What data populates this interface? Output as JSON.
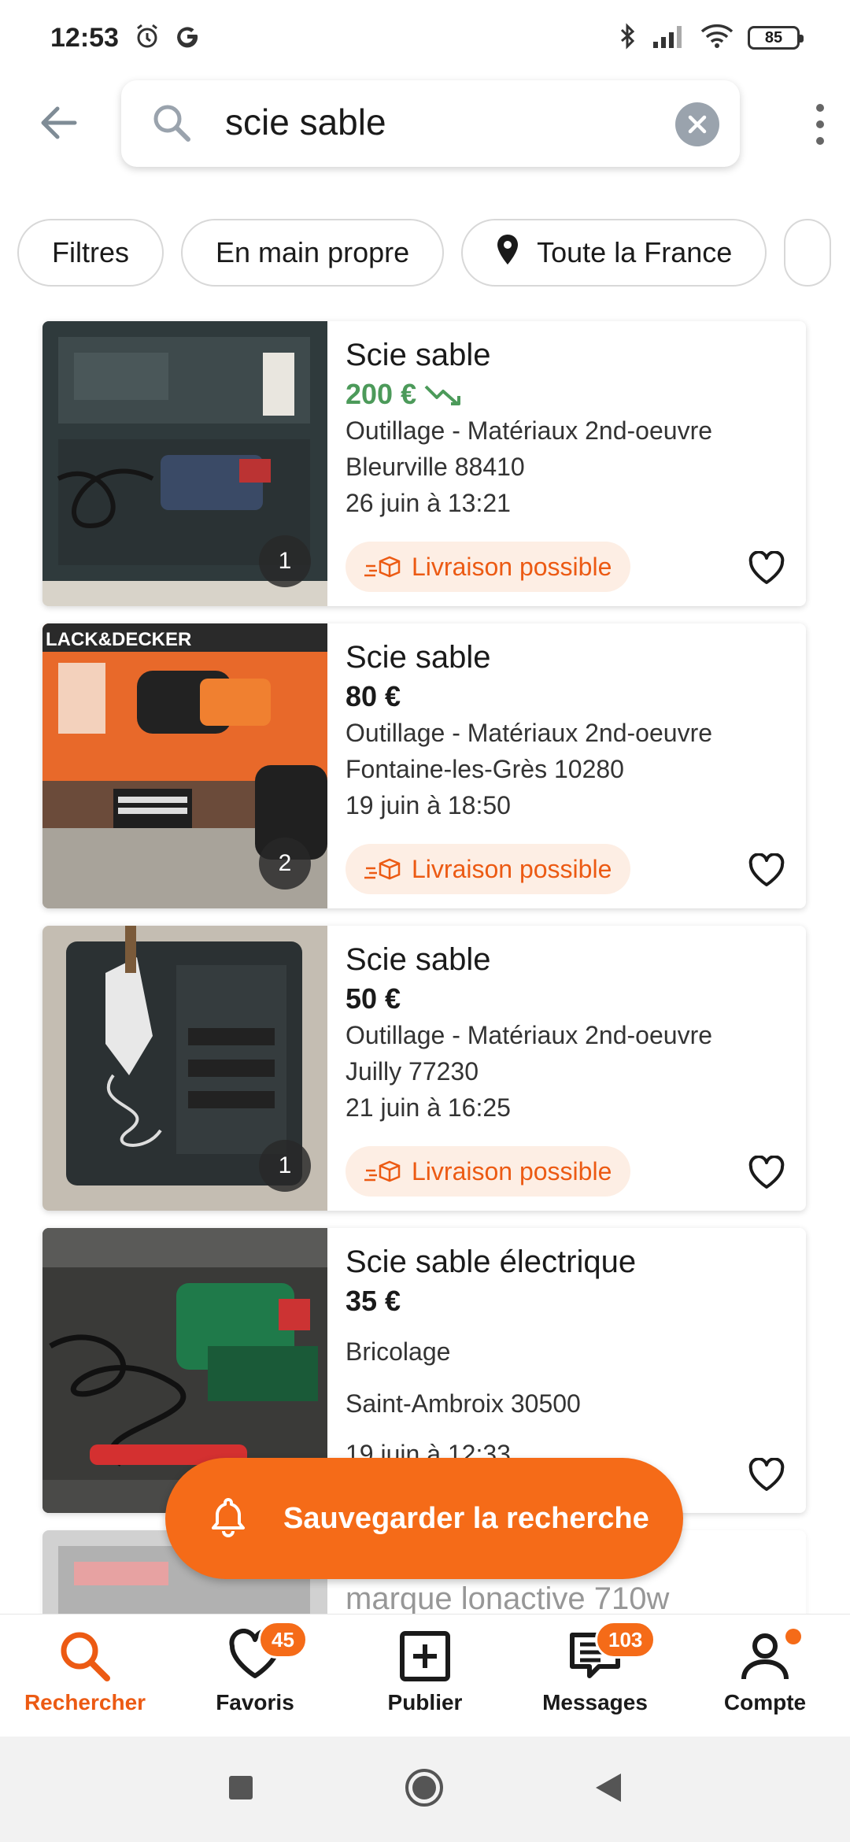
{
  "status_bar": {
    "time": "12:53",
    "battery": "85",
    "icons": [
      "alarm-icon",
      "google-icon",
      "bluetooth-icon",
      "signal-icon",
      "wifi-icon",
      "battery-icon"
    ]
  },
  "search": {
    "query": "scie sable",
    "icons": [
      "back-arrow-icon",
      "search-icon",
      "clear-icon",
      "more-vert-icon"
    ]
  },
  "filters": {
    "chips": [
      "Filtres",
      "En main propre",
      "Toute la France"
    ]
  },
  "listings": [
    {
      "title": "Scie sable",
      "price": "200 €",
      "price_drop": true,
      "category": "Outillage - Matériaux 2nd-oeuvre",
      "location": "Bleurville 88410",
      "date": "26 juin à 13:21",
      "photos": "1",
      "delivery": "Livraison possible"
    },
    {
      "title": "Scie sable",
      "price": "80 €",
      "price_drop": false,
      "category": "Outillage - Matériaux 2nd-oeuvre",
      "location": "Fontaine-les-Grès 10280",
      "date": "19 juin à 18:50",
      "photos": "2",
      "delivery": "Livraison possible",
      "image_brand_text": "LACK&DECKER"
    },
    {
      "title": "Scie sable",
      "price": "50 €",
      "price_drop": false,
      "category": "Outillage - Matériaux 2nd-oeuvre",
      "location": "Juilly 77230",
      "date": "21 juin à 16:25",
      "photos": "1",
      "delivery": "Livraison possible"
    },
    {
      "title": "Scie sable électrique",
      "price": "35 €",
      "price_drop": false,
      "category": "Bricolage",
      "location": "Saint-Ambroix 30500",
      "date": "19 juin à 12:33"
    },
    {
      "title": "marque lonactive 710w"
    }
  ],
  "save_search": {
    "label": "Sauvegarder la recherche"
  },
  "bottom_nav": {
    "items": [
      {
        "label": "Rechercher",
        "active": true
      },
      {
        "label": "Favoris",
        "badge": "45"
      },
      {
        "label": "Publier"
      },
      {
        "label": "Messages",
        "badge": "103"
      },
      {
        "label": "Compte",
        "dot": true
      }
    ]
  },
  "colors": {
    "accent": "#f56b18",
    "accent_text": "#ec5a13",
    "price_drop": "#4c9a5a",
    "delivery_bg": "#fdeee4"
  }
}
